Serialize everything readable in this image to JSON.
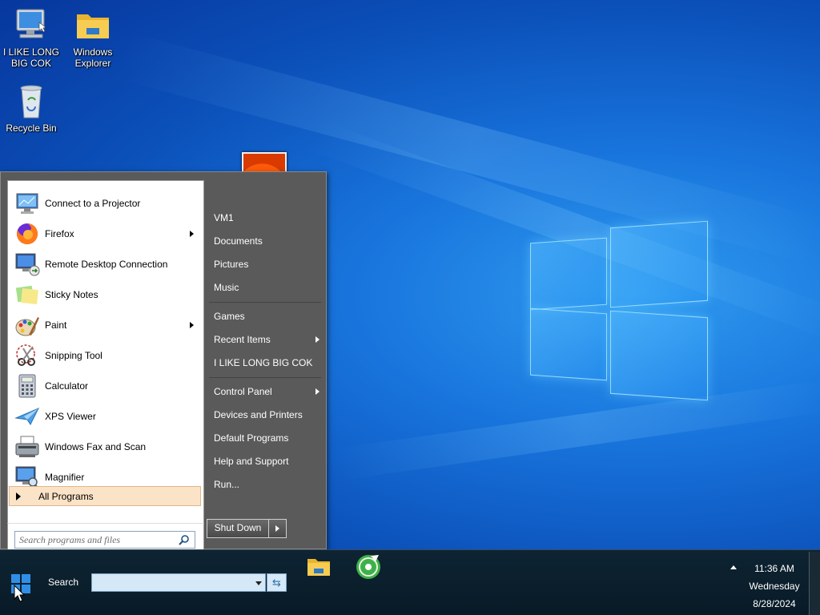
{
  "desktop": {
    "icons": [
      {
        "label": "I LIKE LONG BIG COK",
        "icon": "computer-icon"
      },
      {
        "label": "Windows Explorer",
        "icon": "folder-icon"
      },
      {
        "label": "Recycle Bin",
        "icon": "recycle-bin-icon"
      }
    ]
  },
  "start_menu": {
    "programs": [
      {
        "label": "Connect to a Projector",
        "icon": "projector-icon",
        "has_submenu": false
      },
      {
        "label": "Firefox",
        "icon": "firefox-icon",
        "has_submenu": true
      },
      {
        "label": "Remote Desktop Connection",
        "icon": "remote-desktop-icon",
        "has_submenu": false
      },
      {
        "label": "Sticky Notes",
        "icon": "sticky-notes-icon",
        "has_submenu": false
      },
      {
        "label": "Paint",
        "icon": "paint-icon",
        "has_submenu": true
      },
      {
        "label": "Snipping Tool",
        "icon": "scissors-icon",
        "has_submenu": false
      },
      {
        "label": "Calculator",
        "icon": "calculator-icon",
        "has_submenu": false
      },
      {
        "label": "XPS Viewer",
        "icon": "xps-viewer-icon",
        "has_submenu": false
      },
      {
        "label": "Windows Fax and Scan",
        "icon": "fax-icon",
        "has_submenu": false
      },
      {
        "label": "Magnifier",
        "icon": "magnifier-icon",
        "has_submenu": false
      }
    ],
    "all_programs": "All Programs",
    "search_placeholder": "Search programs and files",
    "right_links": [
      {
        "label": "VM1",
        "has_submenu": false
      },
      {
        "label": "Documents",
        "has_submenu": false
      },
      {
        "label": "Pictures",
        "has_submenu": false
      },
      {
        "label": "Music",
        "has_submenu": false
      },
      {
        "label": "Games",
        "has_submenu": false
      },
      {
        "label": "Recent Items",
        "has_submenu": true
      },
      {
        "label": "I LIKE LONG BIG COK",
        "has_submenu": false
      },
      {
        "label": "Control Panel",
        "has_submenu": true
      },
      {
        "label": "Devices and Printers",
        "has_submenu": false
      },
      {
        "label": "Default Programs",
        "has_submenu": false
      },
      {
        "label": "Help and Support",
        "has_submenu": false
      },
      {
        "label": "Run...",
        "has_submenu": false
      }
    ],
    "shutdown_label": "Shut Down"
  },
  "taskbar": {
    "search_label": "Search",
    "search_value": "",
    "clock": {
      "time": "11:36 AM",
      "day": "Wednesday",
      "date": "8/28/2024"
    }
  },
  "colors": {
    "start_menu_bg": "#5a5a5a",
    "all_programs_highlight": "#fbe3c7",
    "taskbar_bg": "#0e2433"
  }
}
